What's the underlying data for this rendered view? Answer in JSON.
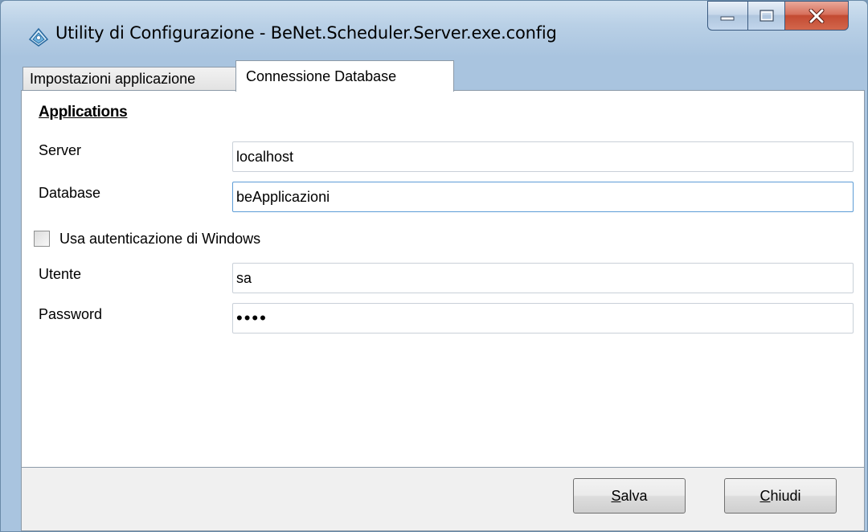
{
  "window": {
    "title": "Utility di Configurazione - BeNet.Scheduler.Server.exe.config"
  },
  "tabs": [
    {
      "label": "Impostazioni applicazione",
      "active": false
    },
    {
      "label": "Connessione Database",
      "active": true
    }
  ],
  "section": {
    "title": "Applications"
  },
  "form": {
    "server": {
      "label": "Server",
      "value": "localhost"
    },
    "database": {
      "label": "Database",
      "value": "beApplicazioni"
    },
    "windows_auth": {
      "label": "Usa autenticazione di Windows",
      "checked": false
    },
    "user": {
      "label": "Utente",
      "value": "sa"
    },
    "password": {
      "label": "Password",
      "value": "••••"
    }
  },
  "buttons": {
    "save": {
      "accel": "S",
      "rest": "alva"
    },
    "close": {
      "accel": "C",
      "rest": "hiudi"
    }
  },
  "icons": {
    "app": "diamond-app-icon",
    "minimize": "minimize-icon",
    "maximize": "maximize-icon",
    "close": "close-icon"
  },
  "colors": {
    "titlebar": "#b9d0e6",
    "close_button": "#c34a32",
    "focus_border": "#5d9cd6"
  }
}
